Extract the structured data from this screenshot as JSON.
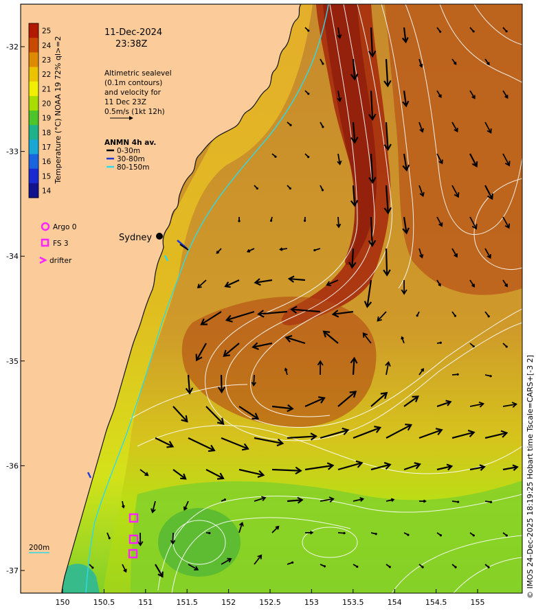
{
  "title": {
    "date": "11-Dec-2024",
    "time": "23:38Z"
  },
  "altimetry_note": [
    "Altimetric sealevel",
    "(0.1m contours)",
    "and velocity for",
    "11 Dec 23Z",
    "0.5m/s (1kt 12h)"
  ],
  "anmn": {
    "title": "ANMN 4h av.",
    "items": [
      {
        "label": "0-30m",
        "color": "#000000"
      },
      {
        "label": "30-80m",
        "color": "#1f3ad6"
      },
      {
        "label": "80-150m",
        "color": "#2fd9e8"
      }
    ]
  },
  "colorbar": {
    "label": "Temperature (°C) NOAA 19 72% ql>=2",
    "ticks": [
      "25",
      "24",
      "23",
      "22",
      "21",
      "20",
      "19",
      "18",
      "17",
      "16",
      "15",
      "14"
    ],
    "colors": [
      "#b11a00",
      "#c84a00",
      "#dd8a00",
      "#ecc300",
      "#f2ee00",
      "#a9dd00",
      "#4dc42a",
      "#1fb28a",
      "#19a8d6",
      "#1a64e0",
      "#1a2ad0",
      "#12128c"
    ]
  },
  "markers": {
    "argo": {
      "label": "Argo 0",
      "color": "#ff22ff"
    },
    "fs": {
      "label": "FS 3",
      "color": "#ff22ff"
    },
    "drifter": {
      "label": "drifter",
      "color": "#ff22ff"
    }
  },
  "places": {
    "sydney": "Sydney"
  },
  "isobath_label": "200m",
  "x_ticks": [
    "150",
    "150.5",
    "151",
    "151.5",
    "152",
    "152.5",
    "153",
    "153.5",
    "154",
    "154.5",
    "155"
  ],
  "y_ticks": [
    "-32",
    "-33",
    "-34",
    "-35",
    "-36",
    "-37"
  ],
  "credit": "© IMOS 24-Dec-2025 18:19:25 Hobart time Tscale=CARS+[-3 2]",
  "colors": {
    "land": "#fbcc9a",
    "coast": "#111111",
    "isobath": "#2fd9e8",
    "contour": "#ffffff",
    "arrow": "#000000"
  }
}
